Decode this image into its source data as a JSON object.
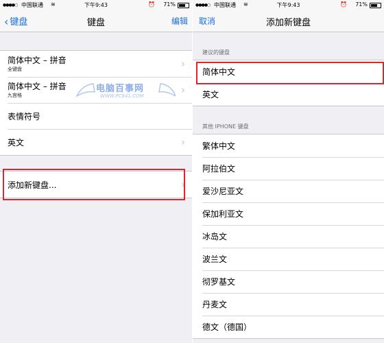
{
  "status_bar": {
    "carrier": "中国联通",
    "time": "下午9:43",
    "battery": "71%",
    "battery_level": 0.71
  },
  "left_screen": {
    "nav": {
      "back_label": "键盘",
      "title": "键盘",
      "edit_label": "编辑"
    },
    "keyboards": [
      {
        "label": "简体中文 – 拼音",
        "sub": "全键盘"
      },
      {
        "label": "简体中文 – 拼音",
        "sub": "九宫格"
      },
      {
        "label": "表情符号"
      },
      {
        "label": "英文"
      }
    ],
    "add_keyboard_label": "添加新键盘..."
  },
  "right_screen": {
    "nav": {
      "cancel_label": "取消",
      "title": "添加新键盘"
    },
    "suggested_header": "建议的键盘",
    "suggested": [
      "简体中文",
      "英文"
    ],
    "other_header": "其他 IPHONE 键盘",
    "other": [
      "繁体中文",
      "阿拉伯文",
      "爱沙尼亚文",
      "保加利亚文",
      "冰岛文",
      "波兰文",
      "彻罗基文",
      "丹麦文",
      "德文（德国）"
    ]
  },
  "watermark": {
    "text": "电脑百事网",
    "url": "WWW.PC841.COM"
  },
  "colors": {
    "accent": "#1a6fe0",
    "highlight": "#d9252c",
    "background": "#efeff4"
  }
}
